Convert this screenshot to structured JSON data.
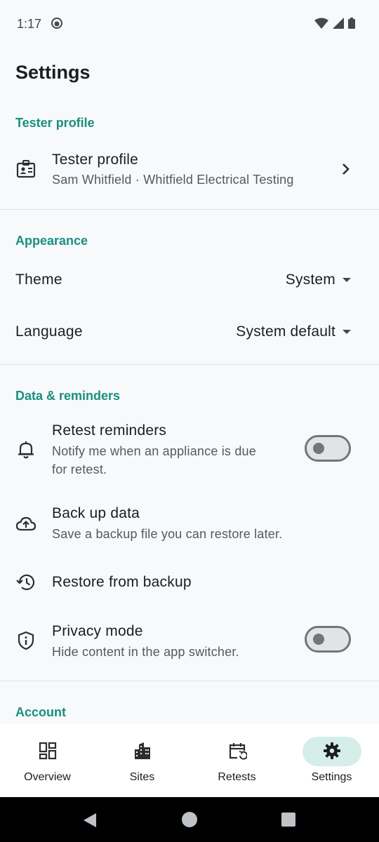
{
  "status_bar": {
    "time": "1:17"
  },
  "page": {
    "title": "Settings"
  },
  "sections": {
    "tester_profile": {
      "header": "Tester profile",
      "item_title": "Tester profile",
      "item_subtitle": "Sam Whitfield · Whitfield Electrical Testing"
    },
    "appearance": {
      "header": "Appearance",
      "theme_label": "Theme",
      "theme_value": "System",
      "language_label": "Language",
      "language_value": "System default"
    },
    "data_reminders": {
      "header": "Data & reminders",
      "retest_title": "Retest reminders",
      "retest_sub_line1": "Notify me when an appliance is due",
      "retest_sub_line2": "for retest.",
      "retest_enabled": false,
      "backup_title": "Back up data",
      "backup_sub": "Save a backup file you can restore later.",
      "restore_title": "Restore from backup",
      "privacy_title": "Privacy mode",
      "privacy_sub": "Hide content in the app switcher.",
      "privacy_enabled": false
    },
    "account": {
      "header": "Account"
    }
  },
  "bottom_nav": {
    "items": [
      {
        "label": "Overview",
        "icon": "dashboard-icon"
      },
      {
        "label": "Sites",
        "icon": "building-icon"
      },
      {
        "label": "Retests",
        "icon": "calendar-history-icon"
      },
      {
        "label": "Settings",
        "icon": "gear-icon",
        "selected": true
      }
    ]
  },
  "colors": {
    "accent": "#1a8f80",
    "selected_pill": "#d5eeea",
    "background": "#f7f9fb"
  }
}
